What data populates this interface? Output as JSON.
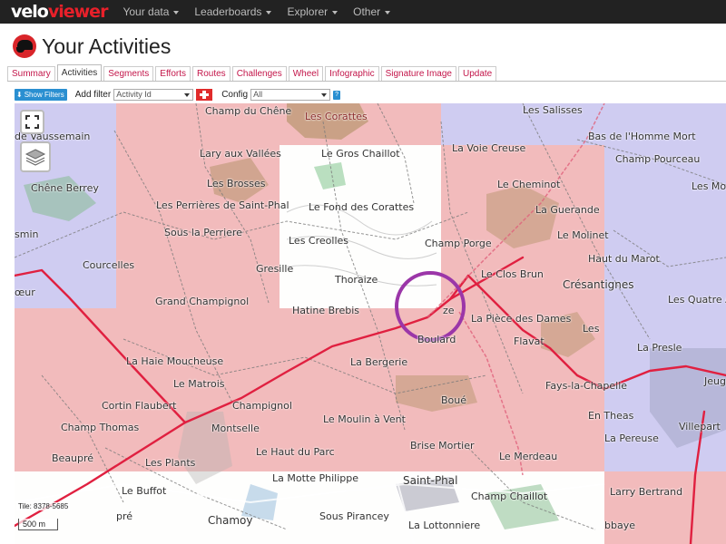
{
  "navbar": {
    "logo_part1": "velo",
    "logo_part2": "viewer",
    "items": [
      "Your data",
      "Leaderboards",
      "Explorer",
      "Other"
    ]
  },
  "header": {
    "title": "Your Activities"
  },
  "tabs": [
    "Summary",
    "Activities",
    "Segments",
    "Efforts",
    "Routes",
    "Challenges",
    "Wheel",
    "Infographic",
    "Signature Image",
    "Update"
  ],
  "active_tab": "Activities",
  "filters": {
    "show_filters_label": "Show Filters",
    "add_filter_label": "Add filter",
    "add_filter_value": "Activity Id",
    "config_label": "Config",
    "config_value": "All",
    "help_label": "?"
  },
  "map": {
    "tile_label": "Tile: 8378-5685",
    "scale_label": "500 m",
    "places": [
      "Champ du Chêne",
      "Les Corattes",
      "Les Salisses",
      "de Vaussemain",
      "Bas de l'Homme Mort",
      "Lary aux Vallées",
      "Le Gros Chaillot",
      "La Voie Creuse",
      "Champ Pourceau",
      "Les Brosses",
      "Chêne Berrey",
      "Le Cheminot",
      "Les Mo",
      "Les Perrières de Saint-Phal",
      "Le Fond des Corattes",
      "La Guerande",
      "Sous la Perriere",
      "Le Molinet",
      "smin",
      "Les Creolles",
      "Champ Porge",
      "Haut du Marot",
      "Courcelles",
      "Gresille",
      "Le Clos Brun",
      "Thoraize",
      "Crésantignes",
      "œur",
      "Grand Champignol",
      "Les Quatre A",
      "Hatine Brebis",
      "ze",
      "La Pièce des Dames",
      "Les",
      "Boulard",
      "Flavat",
      "La Presle",
      "La Haie Moucheuse",
      "La Bergerie",
      "Le Matrois",
      "Fays-la-Chapelle",
      "Jeug",
      "Cortin Flaubert",
      "Champignol",
      "Boué",
      "En Theas",
      "Champ Thomas",
      "Montselle",
      "Le Moulin à Vent",
      "Villepart",
      "Le Haut du Parc",
      "Brise Mortier",
      "La Pereuse",
      "Beaupré",
      "Les Plants",
      "Le Merdeau",
      "La Motte Philippe",
      "Saint-Phal",
      "Larry Bertrand",
      "Le Buffot",
      "Champ Chaillot",
      "pré",
      "Chamoy",
      "Sous Pirancey",
      "La Lottonniere",
      "bbaye"
    ]
  }
}
